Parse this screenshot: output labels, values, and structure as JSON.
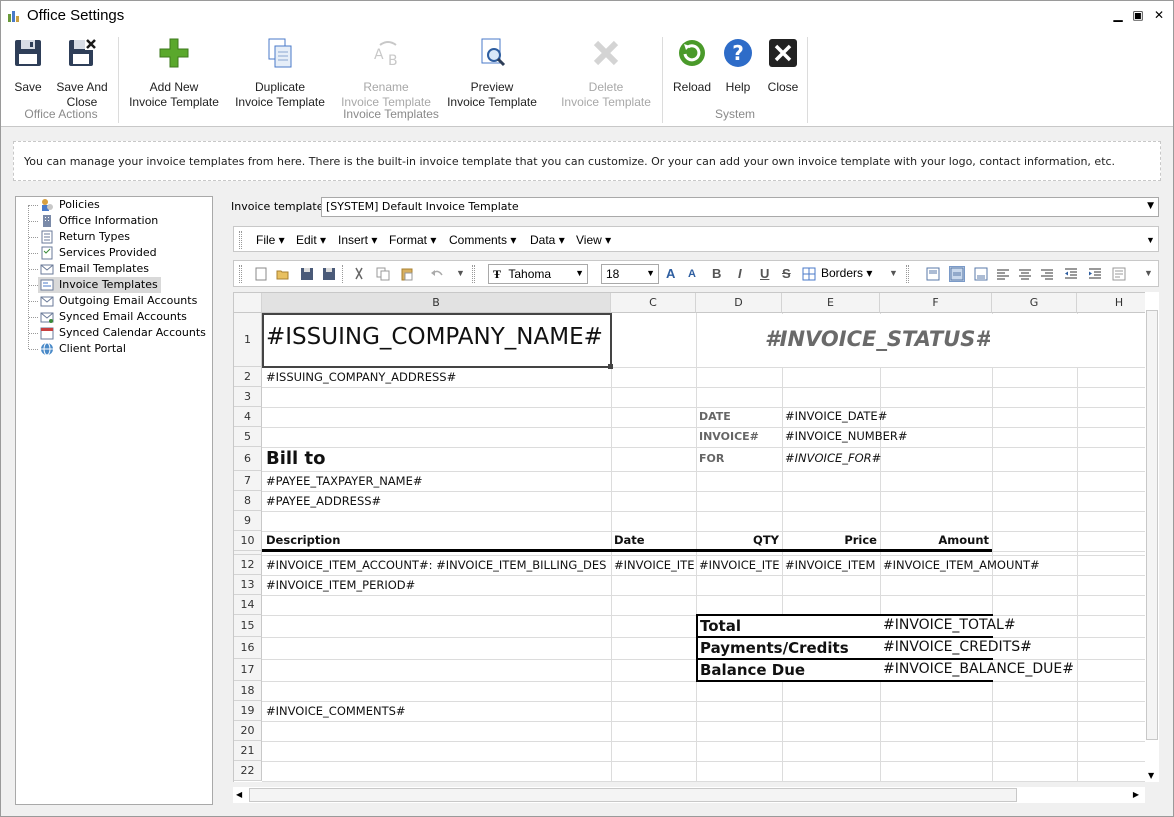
{
  "window": {
    "title": "Office Settings"
  },
  "ribbon": {
    "buttons": {
      "save": "Save",
      "save_close_1": "Save And",
      "save_close_2": "Close",
      "add_1": "Add New",
      "add_2": "Invoice Template",
      "dup_1": "Duplicate",
      "dup_2": "Invoice Template",
      "ren_1": "Rename",
      "ren_2": "Invoice Template",
      "prev_1": "Preview",
      "prev_2": "Invoice Template",
      "del_1": "Delete",
      "del_2": "Invoice Template",
      "reload": "Reload",
      "help": "Help",
      "close": "Close"
    },
    "groups": {
      "office_actions": "Office Actions",
      "invoice_templates": "Invoice Templates",
      "system": "System"
    }
  },
  "info_text": "You can manage your invoice templates from here. There is the built-in invoice template that you can customize. Or your can add your own invoice template with your logo, contact information, etc.",
  "sidebar": {
    "items": [
      {
        "label": "Policies"
      },
      {
        "label": "Office Information"
      },
      {
        "label": "Return Types"
      },
      {
        "label": "Services Provided"
      },
      {
        "label": "Email Templates"
      },
      {
        "label": "Invoice Templates",
        "selected": true
      },
      {
        "label": "Outgoing Email Accounts"
      },
      {
        "label": "Synced Email Accounts"
      },
      {
        "label": "Synced Calendar Accounts"
      },
      {
        "label": "Client Portal"
      }
    ]
  },
  "template_select": {
    "label": "Invoice template:",
    "value": "[SYSTEM] Default Invoice Template"
  },
  "menu": {
    "file": "File",
    "edit": "Edit",
    "insert": "Insert",
    "format": "Format",
    "comments": "Comments",
    "data": "Data",
    "view": "View"
  },
  "format_bar": {
    "font": "Tahoma",
    "size": "18",
    "borders": "Borders",
    "bold": "B",
    "italic": "I",
    "underline": "U",
    "strike": "S"
  },
  "sheet": {
    "columns": [
      "B",
      "C",
      "D",
      "E",
      "F",
      "G",
      "H"
    ],
    "rows": [
      "1",
      "2",
      "3",
      "4",
      "5",
      "6",
      "7",
      "8",
      "9",
      "10",
      "12",
      "13",
      "14",
      "15",
      "16",
      "17",
      "18",
      "19",
      "20",
      "21",
      "22"
    ],
    "cells": {
      "company_name": "#ISSUING_COMPANY_NAME#",
      "invoice_status": "#INVOICE_STATUS#",
      "company_address": "#ISSUING_COMPANY_ADDRESS#",
      "date_label": "DATE",
      "invoice_date": "#INVOICE_DATE#",
      "invoice_label": "INVOICE#",
      "invoice_number": "#INVOICE_NUMBER#",
      "bill_to": "Bill to",
      "for_label": "FOR",
      "invoice_for": "#INVOICE_FOR#",
      "payee_name": "#PAYEE_TAXPAYER_NAME#",
      "payee_address": "#PAYEE_ADDRESS#",
      "hdr_description": "Description",
      "hdr_date": "Date",
      "hdr_qty": "QTY",
      "hdr_price": "Price",
      "hdr_amount": "Amount",
      "item_account": "#INVOICE_ITEM_ACCOUNT#: #INVOICE_ITEM_BILLING_DES",
      "item_date": "#INVOICE_ITE",
      "item_qty": "#INVOICE_ITE",
      "item_price": "#INVOICE_ITEM",
      "item_amount": "#INVOICE_ITEM_AMOUNT#",
      "item_period": "#INVOICE_ITEM_PERIOD#",
      "total_label": "Total",
      "total_value": "#INVOICE_TOTAL#",
      "payments_label": "Payments/Credits",
      "payments_value": "#INVOICE_CREDITS#",
      "balance_label": "Balance Due",
      "balance_value": "#INVOICE_BALANCE_DUE#",
      "comments": "#INVOICE_COMMENTS#"
    }
  }
}
